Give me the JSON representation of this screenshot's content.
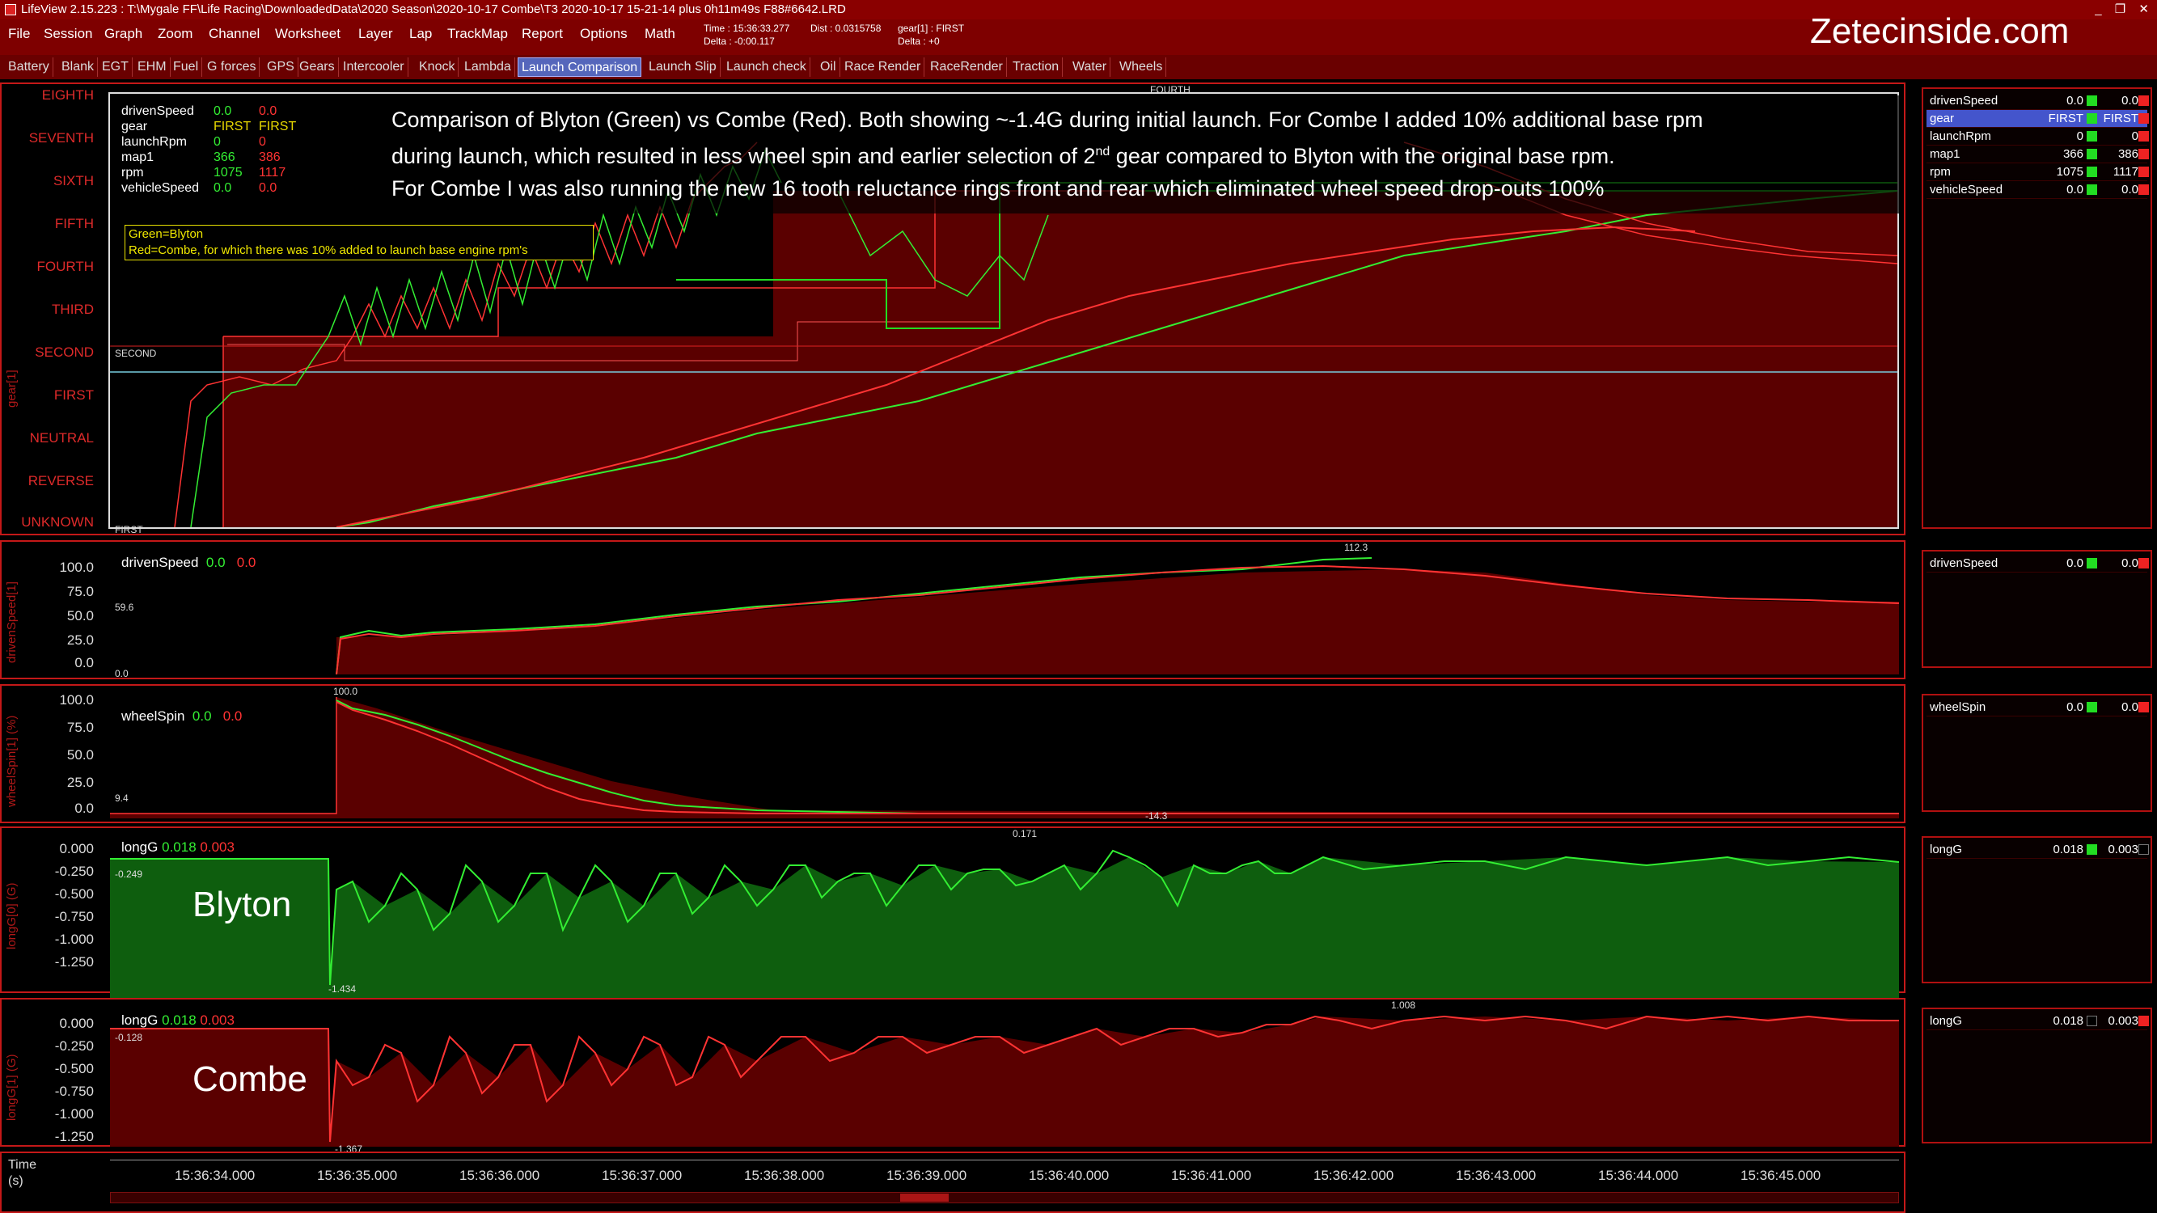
{
  "window": {
    "title": "LifeView 2.15.223  :  T:\\Mygale FF\\Life Racing\\DownloadedData\\2020 Season\\2020-10-17 Combe\\T3 2020-10-17 15-21-14 plus 0h11m49s F88#6642.LRD",
    "controls": [
      "_",
      "❐",
      "✕"
    ]
  },
  "menu": [
    "File",
    "Session",
    "Graph",
    "Zoom",
    "Channel",
    "Worksheet",
    "Layer",
    "Lap",
    "TrackMap",
    "Report",
    "Options",
    "Math"
  ],
  "status": {
    "time": "Time : 15:36:33.277",
    "dist": "Dist : 0.0315758",
    "gear": "gear[1] : FIRST",
    "delta": "Delta : -0:00.117",
    "delta2": "Delta : +0"
  },
  "brand": "Zetecinside.com",
  "tabs": [
    "Battery",
    "Blank",
    "EGT",
    "EHM",
    "Fuel",
    "G forces",
    "GPS",
    "Gears",
    "Intercooler",
    "Knock",
    "Lambda",
    "Launch Comparison",
    "Launch Slip",
    "Launch check",
    "Oil",
    "Race Render",
    "RaceRender",
    "Traction",
    "Water",
    "Wheels"
  ],
  "active_tab": "Launch Comparison",
  "note": {
    "line1": "Comparison of Blyton (Green) vs Combe (Red). Both showing ~-1.4G during initial launch. For Combe I added 10% additional base rpm",
    "line2a": "during launch, which resulted in less wheel spin and earlier selection of 2",
    "line2sup": "nd",
    "line2b": " gear compared to Blyton with the original base rpm.",
    "line3": "For Combe I was also running the new 16 tooth reluctance rings front and rear which eliminated wheel speed drop-outs 100%"
  },
  "annotation": {
    "line1": "Green=Blyton",
    "line2": "Red=Combe, for which there was 10% added to launch base engine rpm's"
  },
  "gear_panel": {
    "vtitle": "gear[1]",
    "levels": [
      "EIGHTH",
      "SEVENTH",
      "SIXTH",
      "FIFTH",
      "FOURTH",
      "THIRD",
      "SECOND",
      "FIRST",
      "NEUTRAL",
      "REVERSE",
      "UNKNOWN"
    ],
    "markers": {
      "top": "FOURTH",
      "cursor": "SECOND",
      "bottom": "FIRST"
    },
    "legend": [
      {
        "name": "drivenSpeed",
        "g": "0.0",
        "r": "0.0"
      },
      {
        "name": "gear",
        "g": "FIRST",
        "r": "FIRST"
      },
      {
        "name": "launchRpm",
        "g": "0",
        "r": "0"
      },
      {
        "name": "map1",
        "g": "366",
        "r": "386"
      },
      {
        "name": "rpm",
        "g": "1075",
        "r": "1117"
      },
      {
        "name": "vehicleSpeed",
        "g": "0.0",
        "r": "0.0"
      }
    ]
  },
  "speed_panel": {
    "vtitle": "drivenSpeed[1]",
    "ticks": [
      "100.0",
      "75.0",
      "50.0",
      "25.0",
      "0.0"
    ],
    "legend": {
      "name": "drivenSpeed",
      "g": "0.0",
      "r": "0.0"
    },
    "markers": {
      "max": "112.3",
      "cursor": "59.6",
      "bottom": "0.0"
    }
  },
  "spin_panel": {
    "vtitle": "wheelSpin[1] (%)",
    "ticks": [
      "100.0",
      "75.0",
      "50.0",
      "25.0",
      "0.0"
    ],
    "legend": {
      "name": "wheelSpin",
      "g": "0.0",
      "r": "0.0"
    },
    "markers": {
      "max": "100.0",
      "cursor": "9.4",
      "min": "-14.3"
    }
  },
  "longg0_panel": {
    "vtitle": "longG[0] (G)",
    "ticks": [
      "0.000",
      "-0.250",
      "-0.500",
      "-0.750",
      "-1.000",
      "-1.250"
    ],
    "legend": {
      "name": "longG",
      "g": "0.018",
      "r": "0.003"
    },
    "markers": {
      "max": "0.171",
      "cursor": "-0.249",
      "min": "-1.434"
    },
    "label": "Blyton"
  },
  "longg1_panel": {
    "vtitle": "longG[1] (G)",
    "ticks": [
      "0.000",
      "-0.250",
      "-0.500",
      "-0.750",
      "-1.000",
      "-1.250"
    ],
    "legend": {
      "name": "longG",
      "g": "0.018",
      "r": "0.003"
    },
    "markers": {
      "max": "1.008",
      "cursor": "-0.128",
      "min": "-1.367"
    },
    "label": "Combe"
  },
  "sidebar": {
    "gear_rows": [
      {
        "name": "drivenSpeed",
        "v1": "0.0",
        "v2": "0.0"
      },
      {
        "name": "gear",
        "v1": "FIRST",
        "v2": "FIRST"
      },
      {
        "name": "launchRpm",
        "v1": "0",
        "v2": "0"
      },
      {
        "name": "map1",
        "v1": "366",
        "v2": "386"
      },
      {
        "name": "rpm",
        "v1": "1075",
        "v2": "1117"
      },
      {
        "name": "vehicleSpeed",
        "v1": "0.0",
        "v2": "0.0"
      }
    ],
    "speed_row": {
      "name": "drivenSpeed",
      "v1": "0.0",
      "v2": "0.0"
    },
    "spin_row": {
      "name": "wheelSpin",
      "v1": "0.0",
      "v2": "0.0"
    },
    "longg0_row": {
      "name": "longG",
      "v1": "0.018",
      "v2": "0.003"
    },
    "longg1_row": {
      "name": "longG",
      "v1": "0.018",
      "v2": "0.003"
    }
  },
  "time_axis": {
    "label1": "Time",
    "label2": "(s)",
    "ticks": [
      "15:36:34.000",
      "15:36:35.000",
      "15:36:36.000",
      "15:36:37.000",
      "15:36:38.000",
      "15:36:39.000",
      "15:36:40.000",
      "15:36:41.000",
      "15:36:42.000",
      "15:36:43.000",
      "15:36:44.000",
      "15:36:45.000"
    ]
  },
  "colors": {
    "blyton": "#33ee33",
    "combe": "#ff3333",
    "panel_border": "#c41818",
    "menubar": "#7e0000"
  }
}
